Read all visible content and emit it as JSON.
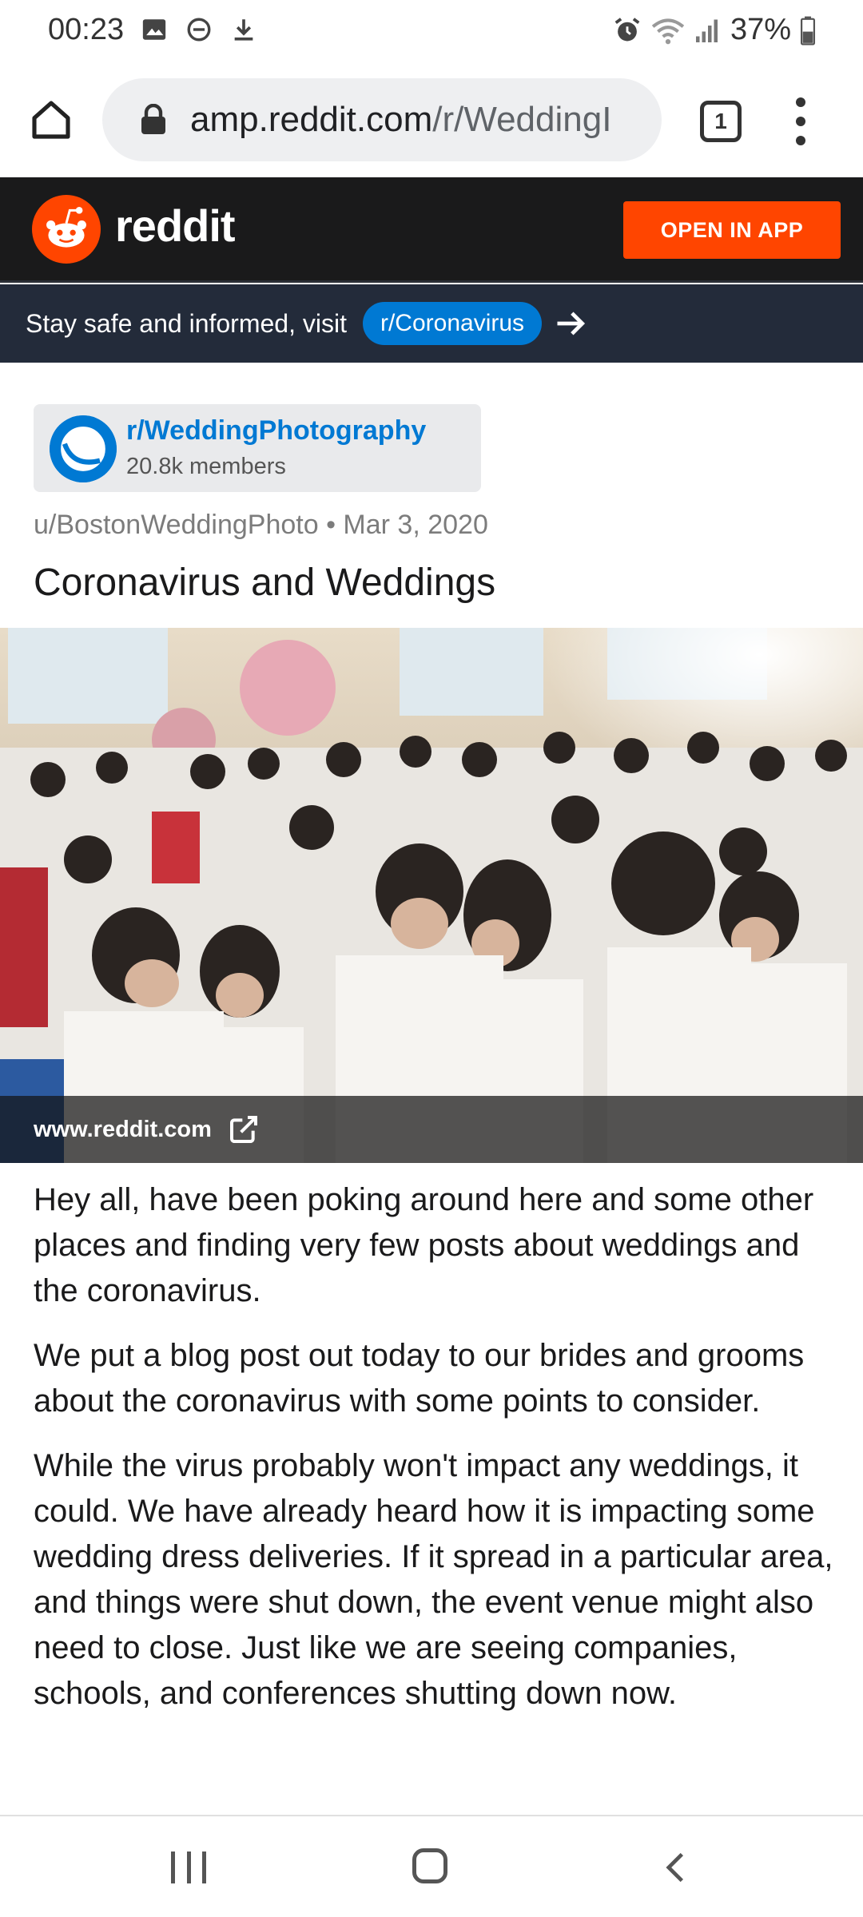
{
  "status_bar": {
    "time": "00:23",
    "battery": "37%",
    "left_icons": [
      "image-icon",
      "dnd-icon",
      "download-icon"
    ],
    "right_icons": [
      "alarm-icon",
      "wifi-icon",
      "signal-icon",
      "battery-icon"
    ]
  },
  "browser": {
    "url_domain": "amp.reddit.com",
    "url_path": "/r/WeddingI",
    "tab_count": "1"
  },
  "reddit_header": {
    "wordmark": "reddit",
    "open_app_label": "OPEN IN APP",
    "accent": "#ff4500"
  },
  "banner": {
    "text": "Stay safe and informed, visit",
    "link": "r/Coronavirus"
  },
  "subreddit": {
    "name": "r/WeddingPhotography",
    "members": "20.8k members"
  },
  "post": {
    "meta": "u/BostonWeddingPhoto • Mar 3, 2020",
    "title": "Coronavirus and Weddings",
    "image_caption": "www.reddit.com",
    "paragraphs": [
      "Hey all, have been poking around here and some other places and finding very few posts about weddings and the coronavirus.",
      "We put a blog post out today to our brides and grooms about the coronavirus with some points to consider.",
      "While the virus probably won't impact any weddings, it could. We have already heard how it is impacting some wedding dress deliveries. If it spread in a particular area, and things were shut down, the event venue might also need to close. Just like we are seeing companies, schools, and conferences shutting down now."
    ]
  }
}
